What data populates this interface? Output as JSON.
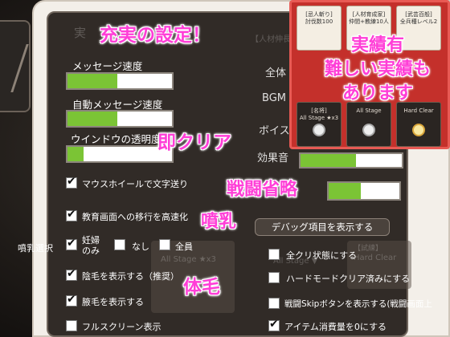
{
  "captions": {
    "title": "充実の設定！",
    "instant_clear": "即クリア",
    "skip_battle": "戦闘省略",
    "lactation": "噴乳",
    "body_hair": "体毛",
    "achievements": [
      "実績有",
      "難しい実績も",
      "あります"
    ]
  },
  "background_ghost_text": {
    "settings_header": "実",
    "volume_all": "全体",
    "volume_bgm": "BGM",
    "volume_voice": "ボイス",
    "volume_se": "効果音",
    "card_title_left": "All Stage ★x3",
    "card_title_right": "Hard Clear",
    "card_header_right": "【試練】",
    "card_header_mid": "【人材伸長",
    "card_mid_left": "All Stage ▼"
  },
  "settings": {
    "message_speed_label": "メッセージ速度",
    "message_speed_level": 0.48,
    "auto_message_speed_label": "自動メッセージ速度",
    "auto_message_speed_level": 0.48,
    "window_opacity_label": "ウインドウの透明度",
    "window_opacity_level": 0.15,
    "mouse_wheel_label": "マウスホイールで文字送り",
    "mouse_wheel_checked": true,
    "fast_transition_label": "教育画面への移行を高速化",
    "fast_transition_checked": true,
    "lactation_select_label": "噴乳選択",
    "lactation_option_pregnant": "妊婦\nのみ",
    "lactation_option_none": "なし",
    "lactation_option_all": "全員",
    "show_pubic_hair_label": "陰毛を表示する（推奨）",
    "show_pubic_hair_checked": true,
    "show_armpit_hair_label": "腋毛を表示する",
    "show_armpit_hair_checked": true,
    "fullscreen_label": "フルスクリーン表示",
    "fullscreen_checked": false,
    "battle_skip_level": 0.45
  },
  "debug": {
    "show_debug_button": "デバッグ項目を表示する",
    "all_clear_label": "全クリ状態にする",
    "all_clear_checked": false,
    "hard_mode_clear_label": "ハードモードクリア済みにする",
    "hard_mode_clear_checked": false,
    "battle_skip_button_label": "戦闘Skipボタンを表示する(戦闘画面上",
    "battle_skip_button_checked": false,
    "item_zero_label": "アイテム消費量を0にする",
    "item_zero_checked": true
  },
  "achievement_cards": [
    {
      "header": "[忌人斬り]",
      "body": "討伐数100"
    },
    {
      "header": "[人材育成家]",
      "body": "仲間+教練10人"
    },
    {
      "header": "[武芸百般]",
      "body": "全兵種レベル2"
    },
    {
      "header": "[名将]",
      "body": "All Stage ★x3"
    },
    {
      "header": "",
      "body": "All Stage"
    },
    {
      "header": "",
      "body": "Hard Clear"
    }
  ],
  "colors": {
    "accent_pink": "#ff3ed7",
    "bar_fill_green": "#7bc435",
    "achievement_red": "#c4302b"
  }
}
